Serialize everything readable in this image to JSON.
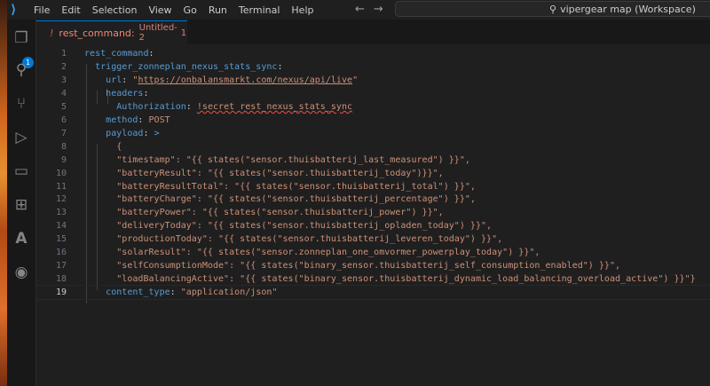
{
  "menu": [
    "File",
    "Edit",
    "Selection",
    "View",
    "Go",
    "Run",
    "Terminal",
    "Help"
  ],
  "search": "vipergear map (Workspace)",
  "explorer_badge": "1",
  "tab": {
    "name": "rest_command:",
    "file": "Untitled-2",
    "problems": "1"
  },
  "lines": [
    [
      {
        "c": "k",
        "t": "rest_command"
      },
      {
        "c": "p",
        "t": ":"
      }
    ],
    [
      {
        "c": "p",
        "t": "  "
      },
      {
        "c": "k",
        "t": "trigger_zonneplan_nexus_stats_sync"
      },
      {
        "c": "p",
        "t": ":"
      }
    ],
    [
      {
        "c": "p",
        "t": "    "
      },
      {
        "c": "k",
        "t": "url"
      },
      {
        "c": "p",
        "t": ": "
      },
      {
        "c": "s",
        "t": "\""
      },
      {
        "c": "u",
        "t": "https://onbalansmarkt.com/nexus/api/live"
      },
      {
        "c": "s",
        "t": "\""
      }
    ],
    [
      {
        "c": "p",
        "t": "    "
      },
      {
        "c": "k",
        "t": "headers"
      },
      {
        "c": "p",
        "t": ":"
      }
    ],
    [
      {
        "c": "p",
        "t": "      "
      },
      {
        "c": "k",
        "t": "Authorization"
      },
      {
        "c": "p",
        "t": ": "
      },
      {
        "c": "sq",
        "t": "!secret rest_nexus_stats_sync"
      }
    ],
    [
      {
        "c": "p",
        "t": "    "
      },
      {
        "c": "k",
        "t": "method"
      },
      {
        "c": "p",
        "t": ": "
      },
      {
        "c": "s",
        "t": "POST"
      }
    ],
    [
      {
        "c": "p",
        "t": "    "
      },
      {
        "c": "k",
        "t": "payload"
      },
      {
        "c": "p",
        "t": ": "
      },
      {
        "c": "t",
        "t": ">"
      }
    ],
    [
      {
        "c": "s",
        "t": "      {"
      }
    ],
    [
      {
        "c": "s",
        "t": "      \"timestamp\": \"{{ states(\"sensor.thuisbatterij_last_measured\") }}\","
      }
    ],
    [
      {
        "c": "s",
        "t": "      \"batteryResult\": \"{{ states(\"sensor.thuisbatterij_today\")}}\","
      }
    ],
    [
      {
        "c": "s",
        "t": "      \"batteryResultTotal\": \"{{ states(\"sensor.thuisbatterij_total\") }}\","
      }
    ],
    [
      {
        "c": "s",
        "t": "      \"batteryCharge\": \"{{ states(\"sensor.thuisbatterij_percentage\") }}\","
      }
    ],
    [
      {
        "c": "s",
        "t": "      \"batteryPower\": \"{{ states(\"sensor.thuisbatterij_power\") }}\","
      }
    ],
    [
      {
        "c": "s",
        "t": "      \"deliveryToday\": \"{{ states(\"sensor.thuisbatterij_opladen_today\") }}\","
      }
    ],
    [
      {
        "c": "s",
        "t": "      \"productionToday\": \"{{ states(\"sensor.thuisbatterij_leveren_today\") }}\","
      }
    ],
    [
      {
        "c": "s",
        "t": "      \"solarResult\": \"{{ states(\"sensor.zonneplan_one_omvormer_powerplay_today\") }}\","
      }
    ],
    [
      {
        "c": "s",
        "t": "      \"selfConsumptionMode\": \"{{ states(\"binary_sensor.thuisbatterij_self_consumption_enabled\") }}\","
      }
    ],
    [
      {
        "c": "s",
        "t": "      \"loadBalancingActive\": \"{{ states(\"binary_sensor.thuisbatterij_dynamic_load_balancing_overload_active\") }}\"}"
      }
    ],
    [
      {
        "c": "p",
        "t": "    "
      },
      {
        "c": "k",
        "t": "content_type"
      },
      {
        "c": "p",
        "t": ": "
      },
      {
        "c": "s",
        "t": "\"application/json\""
      }
    ]
  ]
}
